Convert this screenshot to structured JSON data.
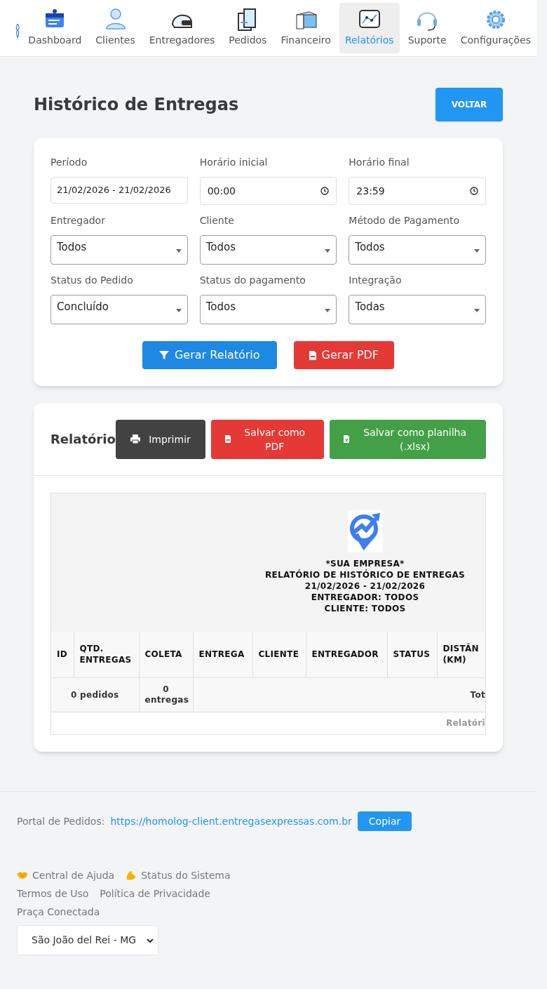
{
  "nav": {
    "items": [
      {
        "label": "Dashboard",
        "selected": false
      },
      {
        "label": "Clientes",
        "selected": false
      },
      {
        "label": "Entregadores",
        "selected": false
      },
      {
        "label": "Pedidos",
        "selected": false
      },
      {
        "label": "Financeiro",
        "selected": false
      },
      {
        "label": "Relatórios",
        "selected": true
      },
      {
        "label": "Suporte",
        "selected": false
      },
      {
        "label": "Configurações",
        "selected": false
      }
    ]
  },
  "page": {
    "title": "Histórico de Entregas",
    "back_button": "VOLTAR"
  },
  "filters": [
    {
      "label": "Período",
      "value": "21/02/2026 - 21/02/2026",
      "kind": "text"
    },
    {
      "label": "Horário inicial",
      "value": "00:00",
      "kind": "time"
    },
    {
      "label": "Horário final",
      "value": "23:59",
      "kind": "time"
    },
    {
      "label": "Entregador",
      "value": "Todos",
      "kind": "select"
    },
    {
      "label": "Cliente",
      "value": "Todos",
      "kind": "select"
    },
    {
      "label": "Método de Pagamento",
      "value": "Todos",
      "kind": "select"
    },
    {
      "label": "Status do Pedido",
      "value": "Concluído",
      "kind": "select"
    },
    {
      "label": "Status do pagamento",
      "value": "Todos",
      "kind": "select"
    },
    {
      "label": "Integração",
      "value": "Todas",
      "kind": "select"
    }
  ],
  "actions": [
    {
      "label": "Gerar Relatório",
      "kind": "filter"
    },
    {
      "label": "Gerar PDF",
      "kind": "pdf"
    }
  ],
  "report": {
    "title": "Relatório",
    "buttons": [
      {
        "label": "Imprimir",
        "kind": "print"
      },
      {
        "label": "Salvar como PDF",
        "kind": "pdf"
      },
      {
        "label": "Salvar como planilha (.xlsx)",
        "kind": "xlsx"
      }
    ],
    "header_lines": [
      "*SUA EMPRESA*",
      "RELATÓRIO DE HISTÓRICO DE ENTREGAS",
      "21/02/2026 - 21/02/2026",
      "ENTREGADOR: TODOS",
      "CLIENTE: TODOS"
    ],
    "columns": [
      "ID",
      "QTD. ENTREGAS",
      "COLETA",
      "ENTREGA",
      "CLIENTE",
      "ENTREGADOR",
      "STATUS",
      "DISTÂN (KM)"
    ],
    "totals": {
      "orders": "0 pedidos",
      "deliveries": "0 entregas",
      "total_label": "Tot"
    },
    "footer_text": "Relatóri"
  },
  "footer": {
    "portal_label": "Portal de Pedidos:",
    "portal_url": "https://homolog-client.entregasexpressas.com.br",
    "copy_button": "Copiar",
    "links": [
      {
        "label": "Central de Ajuda"
      },
      {
        "label": "Status do Sistema"
      },
      {
        "label": "Termos de Uso"
      },
      {
        "label": "Política de Privacidade"
      },
      {
        "label": "Praça Conectada"
      }
    ],
    "city": "São João del Rei - MG"
  }
}
